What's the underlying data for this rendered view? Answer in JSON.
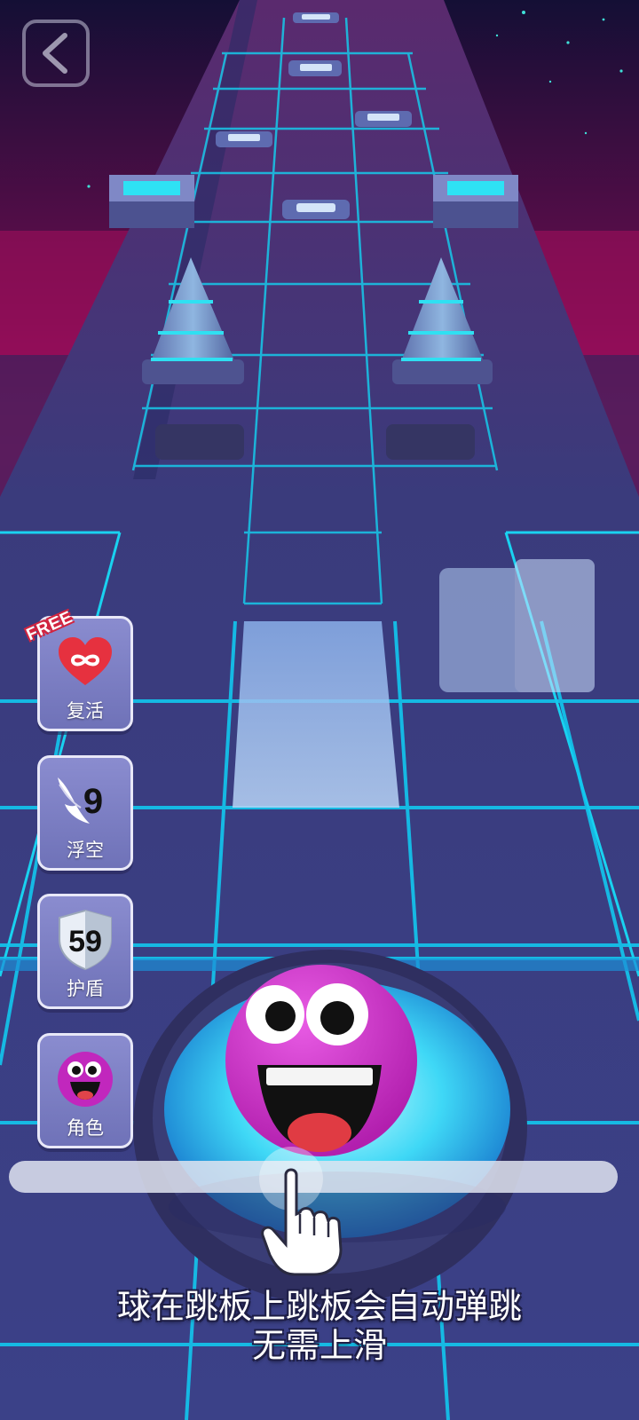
{
  "colors": {
    "neon_cyan": "#16d6f2",
    "sky_magenta": "#b0105e",
    "ball_pink": "#d433cc",
    "tile_dark": "#3a3b7c"
  },
  "nav": {
    "back_icon": "chevron-left-icon"
  },
  "powerups": [
    {
      "label": "复活",
      "icon": "infinity-heart-icon",
      "badge": "FREE"
    },
    {
      "label": "浮空",
      "icon": "wing-icon",
      "count": "9"
    },
    {
      "label": "护盾",
      "icon": "shield-icon",
      "count": "59"
    },
    {
      "label": "角色",
      "icon": "character-face-icon"
    }
  ],
  "tutorial": {
    "line1": "球在跳板上跳板会自动弹跳",
    "line2": "无需上滑",
    "gesture_icon": "pointing-hand-icon"
  }
}
